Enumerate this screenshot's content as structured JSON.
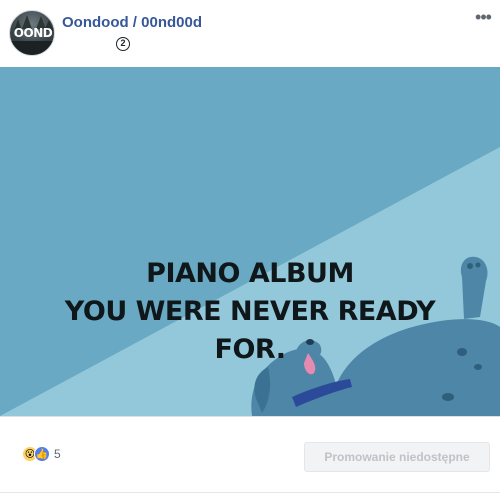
{
  "post": {
    "author": "Oondood / 00nd00d",
    "avatar_text": "OOND",
    "privacy_icon": "globe-icon",
    "privacy_glyph": "2",
    "more_icon": "ellipsis-icon",
    "more_glyph": "•••"
  },
  "media": {
    "headline_lines": [
      "PIANO ALBUM",
      "YOU WERE NEVER READY",
      "FOR."
    ],
    "colors": {
      "dark_teal": "#69a9c3",
      "light_teal": "#93c8da",
      "dog": "#4d86a7",
      "collar": "#2b4a9a",
      "tongue": "#e58bb2"
    }
  },
  "footer": {
    "reaction_icons": [
      "wow-icon",
      "like-icon"
    ],
    "wow_glyph": "😮",
    "like_glyph": "👍",
    "reaction_count": "5",
    "promote_label": "Promowanie niedostępne"
  },
  "colors": {
    "link": "#365899",
    "muted": "#606770",
    "disabled_text": "#bec3c9"
  }
}
